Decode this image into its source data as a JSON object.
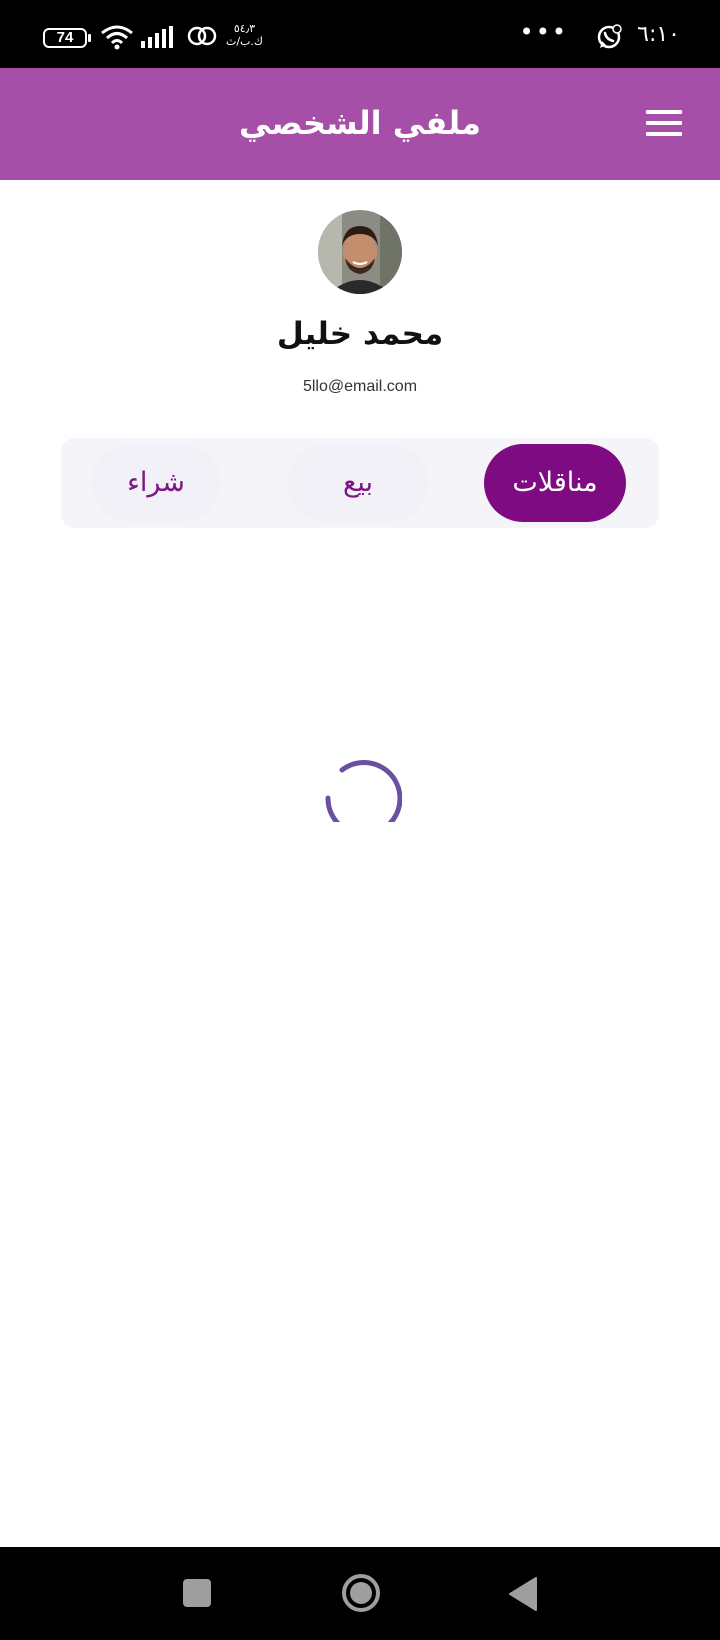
{
  "status_bar": {
    "time": "٦:١٠",
    "battery_level": "74",
    "net_speed_value": "٥٤٫٣",
    "net_speed_unit": "ك.ب/ث",
    "overflow_dots": "•••"
  },
  "app_bar": {
    "title": "ملفي الشخصي"
  },
  "profile": {
    "name": "محمد خليل",
    "email": "5llo@email.com"
  },
  "tabs": {
    "bids": "مناقلات",
    "sell": "بيع",
    "buy": "شراء",
    "selected": "مناقلات"
  },
  "colors": {
    "app_bar": "#a54fa8",
    "active_tab": "#7e0b82",
    "tab_text": "#7d1683",
    "spinner": "#6a4fa3"
  },
  "icons": {
    "menu": "hamburger-menu-icon",
    "whatsapp": "whatsapp-icon",
    "wifi": "wifi-icon",
    "signal": "cellular-signal-icon",
    "data": "data-saver-icon",
    "recent": "square-recents-icon",
    "home": "circle-home-icon",
    "back": "triangle-back-icon"
  }
}
